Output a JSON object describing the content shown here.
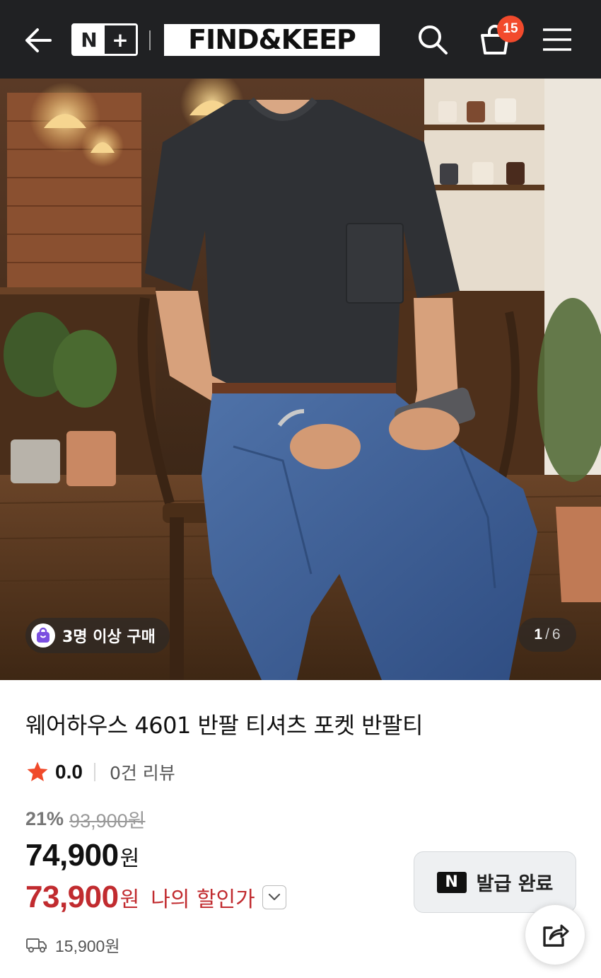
{
  "header": {
    "logo_left": "N",
    "logo_right": "+",
    "brand": "FIND&KEEP",
    "cart_count": "15",
    "icons": [
      "back-arrow-icon",
      "search-icon",
      "cart-icon",
      "menu-icon"
    ]
  },
  "gallery": {
    "buyer_badge": "3명 이상 구매",
    "current_page": "1",
    "page_separator": "/",
    "total_pages": "6"
  },
  "product": {
    "title": "웨어하우스 4601 반팔 티셔츠 포켓 반팔티",
    "rating": "0.0",
    "review_count": "0건 리뷰",
    "discount_rate": "21%",
    "original_price": "93,900원",
    "sale_price": "74,900",
    "sale_unit": "원",
    "my_price": "73,900",
    "my_unit": "원",
    "my_price_label": "나의 할인가",
    "shipping_fee": "15,900원"
  },
  "coupon": {
    "icon_text": "N",
    "label": "발급 완료"
  },
  "colors": {
    "header_bg": "#202123",
    "badge_red": "#f24a2c",
    "star": "#f04a2a",
    "discount_price": "#c12b2f"
  }
}
